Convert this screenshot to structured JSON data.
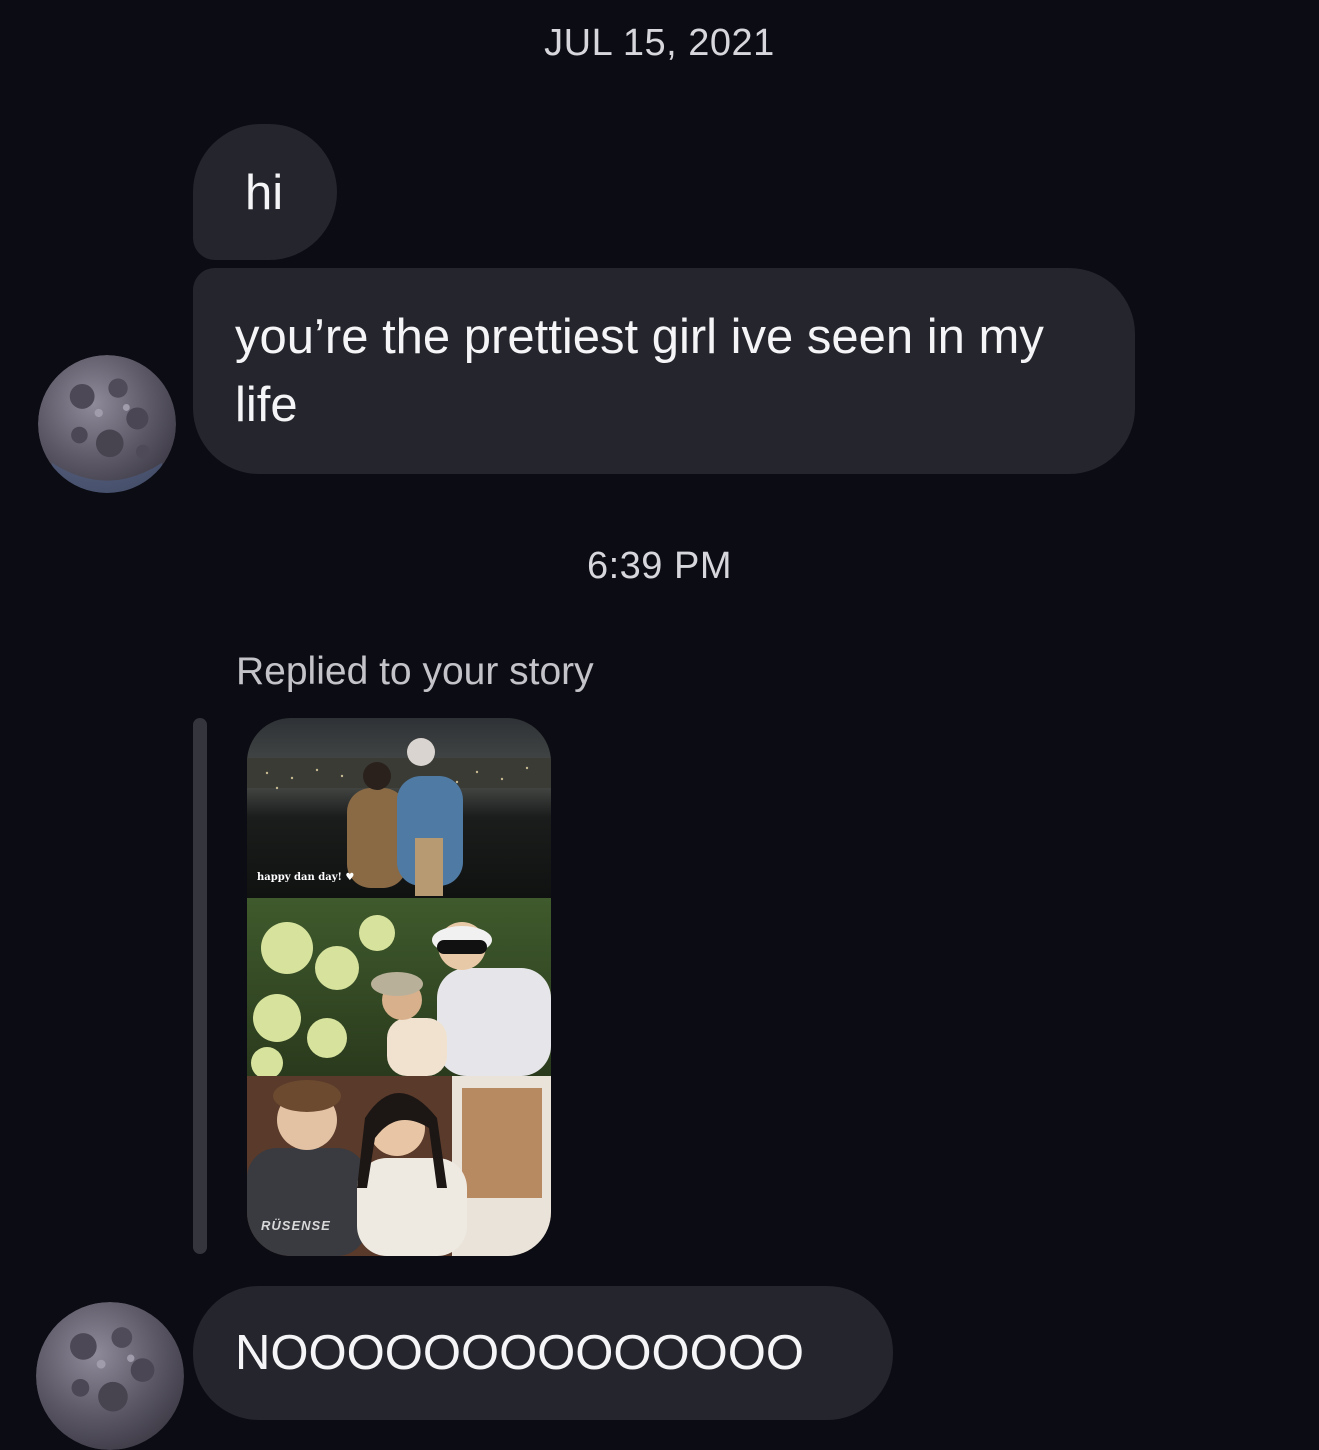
{
  "conversation": {
    "date_header": "JUL 15, 2021",
    "time_header": "6:39 PM"
  },
  "messages": [
    {
      "text": "hi"
    },
    {
      "text": "you’re the prettiest girl ive seen in my life"
    },
    {
      "text": "NOOOOOOOOOOOOOO"
    }
  ],
  "story_reply": {
    "label": "Replied to your story",
    "caption": "happy dan day! ♥",
    "shirt_text": "RÜSENSE"
  },
  "icons": {
    "avatar": "moon-avatar-icon"
  },
  "colors": {
    "background": "#0c0d14",
    "bubble": "#25262d",
    "text": "#f5f5f7",
    "muted_text": "#c3c3c9"
  }
}
